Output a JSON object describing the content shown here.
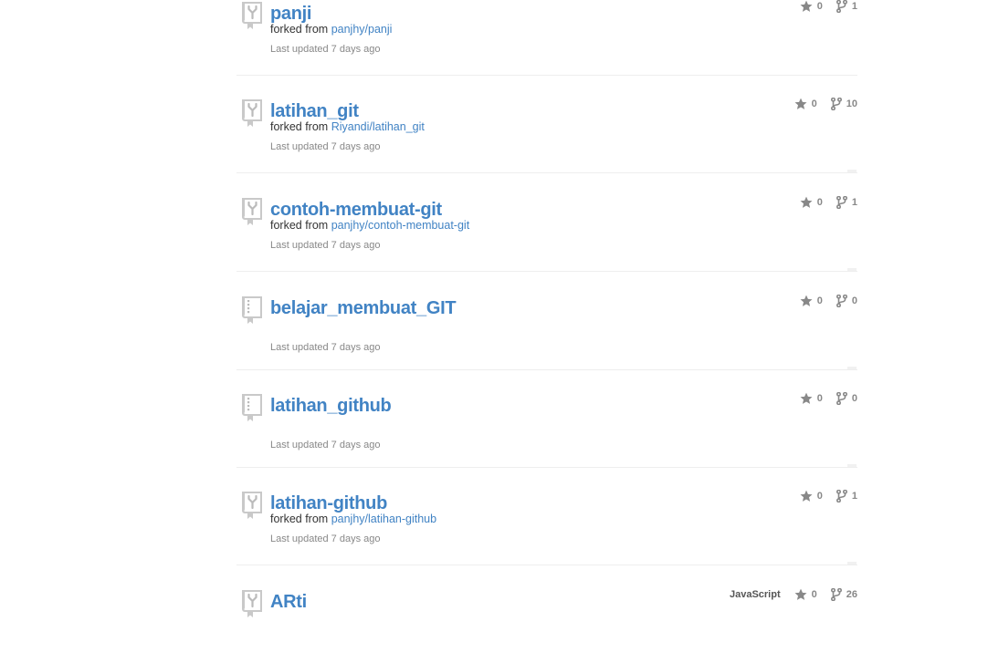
{
  "colors": {
    "link": "#4183c4",
    "muted": "#888888",
    "icon": "#bbbbbb",
    "divider": "#eeeeee"
  },
  "labels": {
    "forked_prefix": "forked from"
  },
  "repos": [
    {
      "name": "panji",
      "forked_from": "panjhy/panji",
      "updated": "Last updated 7 days ago",
      "language": "",
      "stars": "0",
      "forks": "1",
      "icon": "repo-forked-icon"
    },
    {
      "name": "latihan_git",
      "forked_from": "Riyandi/latihan_git",
      "updated": "Last updated 7 days ago",
      "language": "",
      "stars": "0",
      "forks": "10",
      "icon": "repo-forked-icon"
    },
    {
      "name": "contoh-membuat-git",
      "forked_from": "panjhy/contoh-membuat-git",
      "updated": "Last updated 7 days ago",
      "language": "",
      "stars": "0",
      "forks": "1",
      "icon": "repo-forked-icon"
    },
    {
      "name": "belajar_membuat_GIT",
      "forked_from": "",
      "updated": "Last updated 7 days ago",
      "language": "",
      "stars": "0",
      "forks": "0",
      "icon": "repo-icon"
    },
    {
      "name": "latihan_github",
      "forked_from": "",
      "updated": "Last updated 7 days ago",
      "language": "",
      "stars": "0",
      "forks": "0",
      "icon": "repo-icon"
    },
    {
      "name": "latihan-github",
      "forked_from": "panjhy/latihan-github",
      "updated": "Last updated 7 days ago",
      "language": "",
      "stars": "0",
      "forks": "1",
      "icon": "repo-forked-icon"
    },
    {
      "name": "ARti",
      "forked_from": "",
      "updated": "",
      "language": "JavaScript",
      "stars": "0",
      "forks": "26",
      "icon": "repo-forked-icon"
    }
  ]
}
